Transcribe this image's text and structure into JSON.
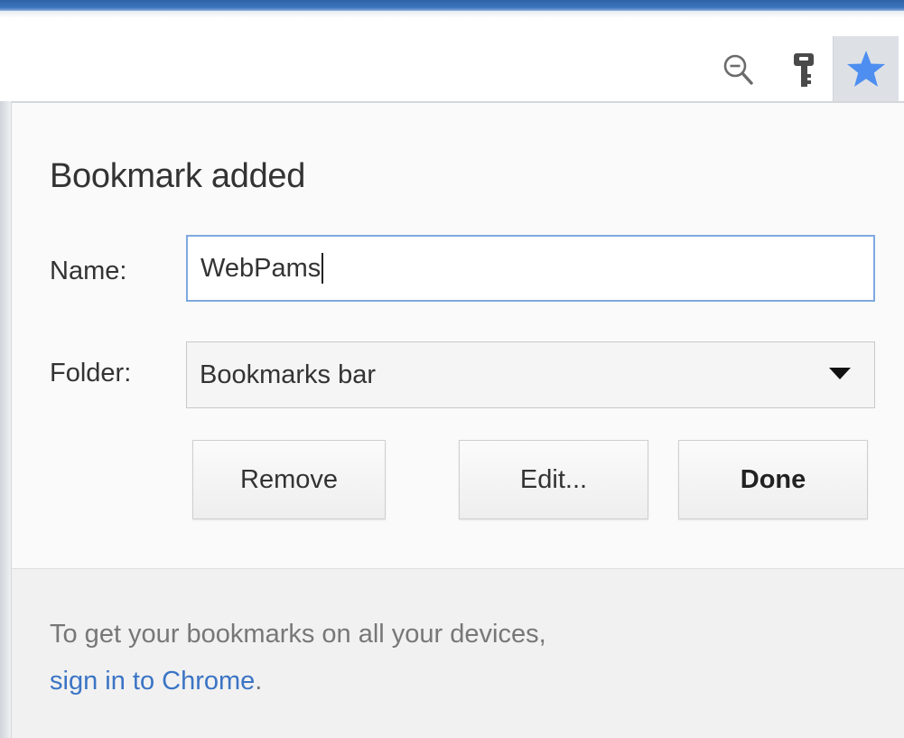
{
  "toolbar": {
    "zoom_icon": "zoom-out-icon",
    "key_icon": "key-icon",
    "star_icon": "bookmark-star-icon",
    "star_color": "#4d8ef0"
  },
  "bubble": {
    "title": "Bookmark added",
    "name_label": "Name:",
    "name_value": "WebPams",
    "folder_label": "Folder:",
    "folder_value": "Bookmarks bar",
    "buttons": {
      "remove": "Remove",
      "edit": "Edit...",
      "done": "Done"
    },
    "promo": {
      "text": "To get your bookmarks on all your devices,",
      "link": "sign in to Chrome",
      "link_suffix": "."
    }
  }
}
